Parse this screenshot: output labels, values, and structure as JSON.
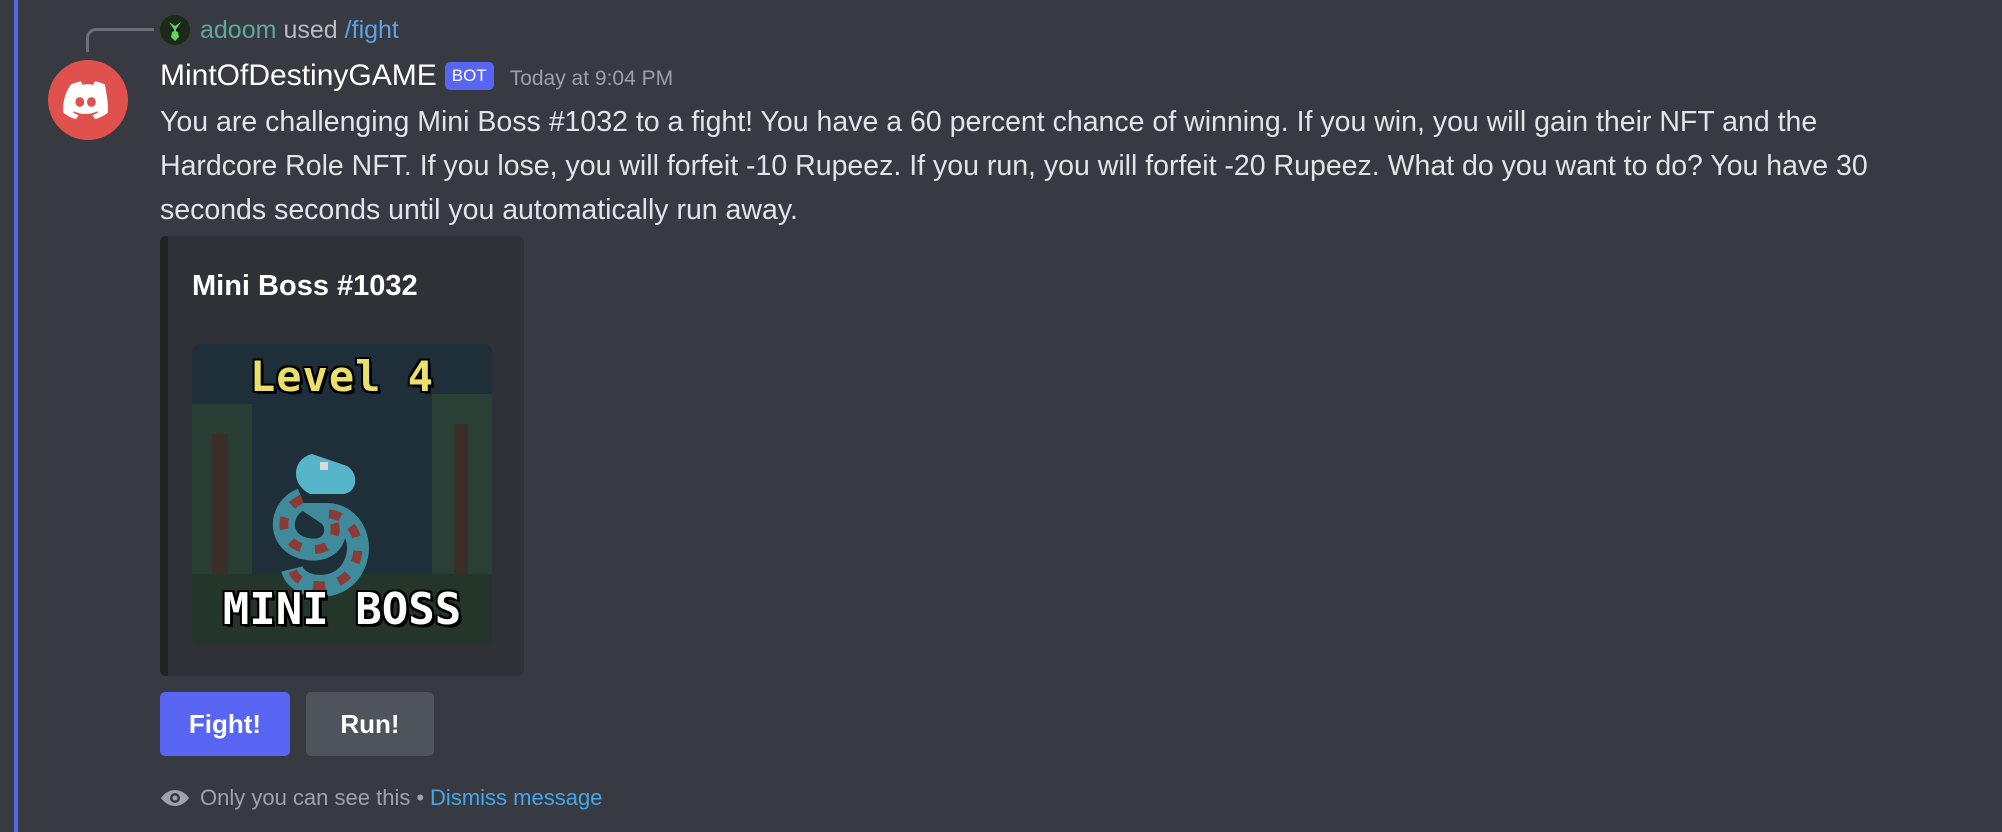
{
  "reply": {
    "username": "adoom",
    "used_text": "used",
    "command": "/fight"
  },
  "message": {
    "author": "MintOfDestinyGAME",
    "bot_tag": "BOT",
    "timestamp": "Today at 9:04 PM",
    "content": "You are challenging Mini Boss #1032 to a fight! You have a 60 percent chance of winning. If you win, you will gain their NFT and the Hardcore Role NFT. If you lose, you will forfeit -10 Rupeez. If you run, you will forfeit -20 Rupeez. What do you want to do? You have 30 seconds seconds until you automatically run away."
  },
  "embed": {
    "title": "Mini Boss #1032",
    "image_level_text": "Level 4",
    "image_caption_text": "MINI BOSS"
  },
  "buttons": {
    "fight_label": "Fight!",
    "run_label": "Run!"
  },
  "footer": {
    "visibility_text": "Only you can see this",
    "separator": "•",
    "dismiss_label": "Dismiss message"
  },
  "icons": {
    "reply_avatar": "alien-avatar-icon",
    "author_avatar": "discord-logo-icon",
    "visibility": "eye-icon"
  },
  "colors": {
    "background": "#383a42",
    "accent": "#5865f2",
    "avatar_red": "#e0514d",
    "link": "#45a6e8",
    "reply_username": "#5fa89c",
    "secondary_button": "#4f545c"
  }
}
